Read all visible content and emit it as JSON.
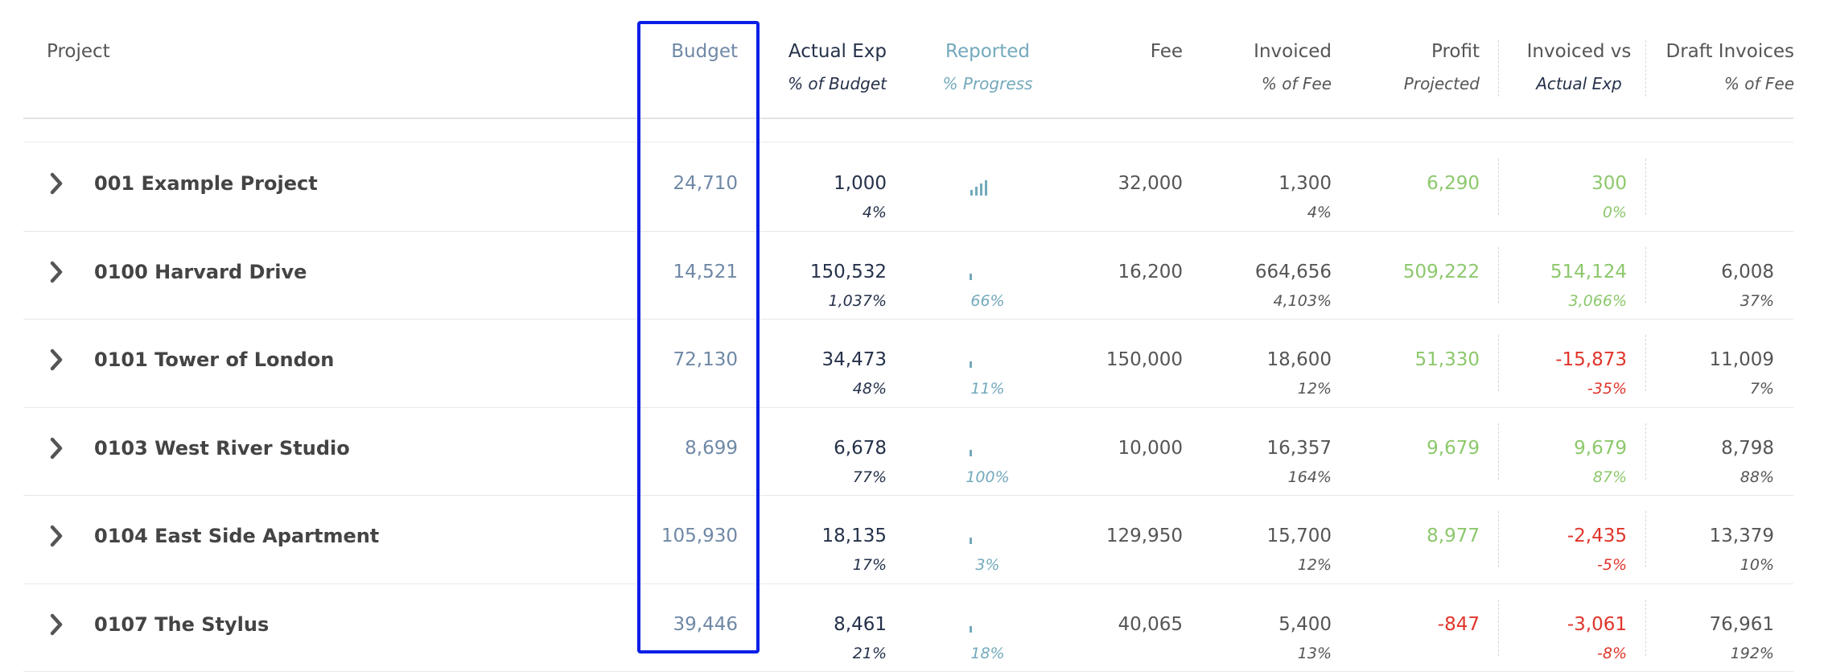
{
  "columns": {
    "project": {
      "label": "Project"
    },
    "budget": {
      "label": "Budget"
    },
    "actual": {
      "label": "Actual Exp",
      "sub": "% of Budget"
    },
    "reported": {
      "label": "Reported",
      "sub": "% Progress"
    },
    "fee": {
      "label": "Fee"
    },
    "invoiced": {
      "label": "Invoiced",
      "sub": "% of Fee"
    },
    "profit": {
      "label": "Profit",
      "sub": "Projected"
    },
    "inv_vs_actual": {
      "label": "Invoiced vs",
      "sub": "Actual Exp"
    },
    "draft": {
      "label": "Draft Invoices",
      "sub": "% of Fee"
    }
  },
  "colors": {
    "highlight_border": "#0a1fe6",
    "positive": "#8cc86b",
    "negative": "#e0352b",
    "budget_text": "#6f88a6",
    "reported_text": "#73a9bc"
  },
  "rows": [
    {
      "name": "001 Example Project",
      "budget": "24,710",
      "actual": "1,000",
      "actual_pct": "4%",
      "reported_pct": "",
      "reported_icon": "bar-chart-icon",
      "fee": "32,000",
      "invoiced": "1,300",
      "invoiced_pct": "4%",
      "profit": "6,290",
      "profit_sign": "positive",
      "ivsa": "300",
      "ivsa_pct": "0%",
      "ivsa_sign": "positive",
      "draft": "",
      "draft_pct": ""
    },
    {
      "name": "0100 Harvard Drive",
      "budget": "14,521",
      "actual": "150,532",
      "actual_pct": "1,037%",
      "reported_pct": "66%",
      "reported_icon": "progress-tick-icon",
      "fee": "16,200",
      "invoiced": "664,656",
      "invoiced_pct": "4,103%",
      "profit": "509,222",
      "profit_sign": "positive",
      "ivsa": "514,124",
      "ivsa_pct": "3,066%",
      "ivsa_sign": "positive",
      "draft": "6,008",
      "draft_pct": "37%"
    },
    {
      "name": "0101 Tower of London",
      "budget": "72,130",
      "actual": "34,473",
      "actual_pct": "48%",
      "reported_pct": "11%",
      "reported_icon": "progress-tick-icon",
      "fee": "150,000",
      "invoiced": "18,600",
      "invoiced_pct": "12%",
      "profit": "51,330",
      "profit_sign": "positive",
      "ivsa": "-15,873",
      "ivsa_pct": "-35%",
      "ivsa_sign": "negative",
      "draft": "11,009",
      "draft_pct": "7%"
    },
    {
      "name": "0103 West River Studio",
      "budget": "8,699",
      "actual": "6,678",
      "actual_pct": "77%",
      "reported_pct": "100%",
      "reported_icon": "progress-tick-icon",
      "fee": "10,000",
      "invoiced": "16,357",
      "invoiced_pct": "164%",
      "profit": "9,679",
      "profit_sign": "positive",
      "ivsa": "9,679",
      "ivsa_pct": "87%",
      "ivsa_sign": "positive",
      "draft": "8,798",
      "draft_pct": "88%"
    },
    {
      "name": "0104 East Side Apartment",
      "budget": "105,930",
      "actual": "18,135",
      "actual_pct": "17%",
      "reported_pct": "3%",
      "reported_icon": "progress-tick-icon",
      "fee": "129,950",
      "invoiced": "15,700",
      "invoiced_pct": "12%",
      "profit": "8,977",
      "profit_sign": "positive",
      "ivsa": "-2,435",
      "ivsa_pct": "-5%",
      "ivsa_sign": "negative",
      "draft": "13,379",
      "draft_pct": "10%"
    },
    {
      "name": "0107 The Stylus",
      "budget": "39,446",
      "actual": "8,461",
      "actual_pct": "21%",
      "reported_pct": "18%",
      "reported_icon": "progress-tick-icon",
      "fee": "40,065",
      "invoiced": "5,400",
      "invoiced_pct": "13%",
      "profit": "-847",
      "profit_sign": "negative",
      "ivsa": "-3,061",
      "ivsa_pct": "-8%",
      "ivsa_sign": "negative",
      "draft": "76,961",
      "draft_pct": "192%"
    }
  ]
}
